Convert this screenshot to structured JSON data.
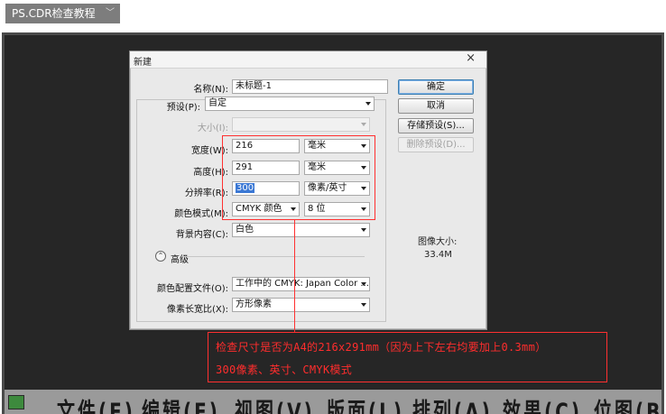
{
  "tag": {
    "label": "PS.CDR检查教程",
    "chevron": "﹀"
  },
  "dialog": {
    "title": "新建",
    "close_glyph": "×",
    "name": {
      "label": "名称(N):",
      "value": "未标题-1"
    },
    "preset": {
      "label": "预设(P):",
      "value": "自定"
    },
    "size": {
      "label": "大小(I):",
      "value": ""
    },
    "width": {
      "label": "宽度(W):",
      "value": "216",
      "unit": "毫米"
    },
    "height": {
      "label": "高度(H):",
      "value": "291",
      "unit": "毫米"
    },
    "resolution": {
      "label": "分辨率(R):",
      "value": "300",
      "unit": "像素/英寸"
    },
    "color_mode": {
      "label": "颜色模式(M):",
      "value": "CMYK 颜色",
      "depth": "8 位"
    },
    "background": {
      "label": "背景内容(C):",
      "value": "白色"
    },
    "advanced": {
      "label": "高级",
      "icon_glyph": "⌃"
    },
    "color_profile": {
      "label": "颜色配置文件(O):",
      "value": "工作中的 CMYK: Japan Color ..."
    },
    "pixel_aspect": {
      "label": "像素长宽比(X):",
      "value": "方形像素"
    },
    "buttons": {
      "ok": "确定",
      "cancel": "取消",
      "save_preset": "存储预设(S)...",
      "delete_preset": "删除预设(D)..."
    },
    "image_size": {
      "label": "图像大小:",
      "value": "33.4M"
    }
  },
  "annotation": {
    "line1": "检查尺寸是否为A4的216x291mm（因为上下左右均要加上0.3mm）",
    "line2": "300像素、英寸、CMYK模式",
    "color": "#ff3030"
  },
  "menubar": {
    "items": [
      "文件(F)",
      "编辑(E)",
      "视图(V)",
      "版面(L)",
      "排列(A)",
      "效果(C)",
      "位图(B)"
    ]
  }
}
